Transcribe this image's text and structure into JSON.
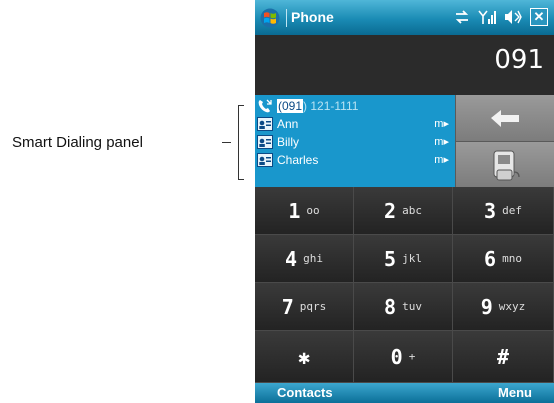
{
  "annotation": {
    "label": "Smart Dialing panel"
  },
  "titlebar": {
    "title": "Phone",
    "status_close": "✕"
  },
  "display": {
    "number": "091"
  },
  "smart_dial": {
    "match_number_highlight": "(091",
    "match_number_rest": ") 121-1111",
    "contacts": [
      {
        "name": "Ann",
        "type": "m"
      },
      {
        "name": "Billy",
        "type": "m"
      },
      {
        "name": "Charles",
        "type": "m"
      }
    ]
  },
  "keypad": {
    "keys": [
      {
        "digit": "1",
        "letters": "oo"
      },
      {
        "digit": "2",
        "letters": "abc"
      },
      {
        "digit": "3",
        "letters": "def"
      },
      {
        "digit": "4",
        "letters": "ghi"
      },
      {
        "digit": "5",
        "letters": "jkl"
      },
      {
        "digit": "6",
        "letters": "mno"
      },
      {
        "digit": "7",
        "letters": "pqrs"
      },
      {
        "digit": "8",
        "letters": "tuv"
      },
      {
        "digit": "9",
        "letters": "wxyz"
      },
      {
        "digit": "✱",
        "letters": ""
      },
      {
        "digit": "0",
        "letters": "+"
      },
      {
        "digit": "#",
        "letters": ""
      }
    ]
  },
  "softkeys": {
    "left": "Contacts",
    "right": "Menu"
  },
  "colors": {
    "accent": "#1997cc",
    "title_bar": "#1a8bb4",
    "keypad_bg": "#2d2d2d"
  }
}
